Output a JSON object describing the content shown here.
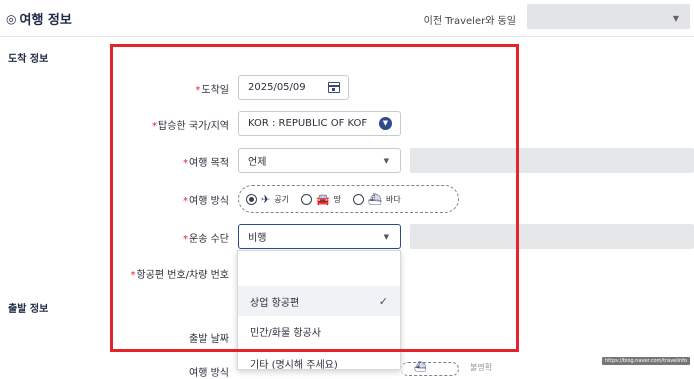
{
  "header": {
    "title": "여행 정보",
    "title_icon": "globe-icon",
    "prev_traveler_label": "이전 Traveler와 동일",
    "prev_traveler_value": ""
  },
  "arrival": {
    "section_title": "도착 정보",
    "arrival_date": {
      "label": "도착일",
      "required": "*",
      "value": "2025/05/09"
    },
    "country": {
      "label": "탑승한 국가/지역",
      "required": "*",
      "value": "KOR : REPUBLIC OF KOF"
    },
    "purpose": {
      "label": "여행 목적",
      "required": "*",
      "value": "언제",
      "extra_value": ""
    },
    "method": {
      "label": "여행 방식",
      "required": "*",
      "options": [
        {
          "label": "공기",
          "icon": "airplane-icon",
          "selected": true
        },
        {
          "label": "땅",
          "icon": "car-icon",
          "selected": false
        },
        {
          "label": "바다",
          "icon": "ship-icon",
          "selected": false
        }
      ]
    },
    "transport": {
      "label": "운송 수단",
      "required": "*",
      "value": "비행",
      "extra_value": ""
    },
    "flight_number": {
      "label": "항공편 번호/차량 번호",
      "required": "*"
    },
    "dropdown_options": [
      {
        "label": "",
        "selected": false
      },
      {
        "label": "상업 항공편",
        "selected": true
      },
      {
        "label": "민간/화물 항공사",
        "selected": false
      },
      {
        "label": "기타 (명시해 주세요)",
        "selected": false
      }
    ]
  },
  "departure": {
    "section_title": "출발 정보",
    "date_label": "출발 날짜",
    "method_label_partial": "여행 방식",
    "other_partial": "불명확"
  },
  "watermark": "https://blog.naver.com/travelinfo",
  "colors": {
    "highlight": "#e3242b",
    "accent": "#2d4a8a",
    "required": "#e3242b"
  }
}
